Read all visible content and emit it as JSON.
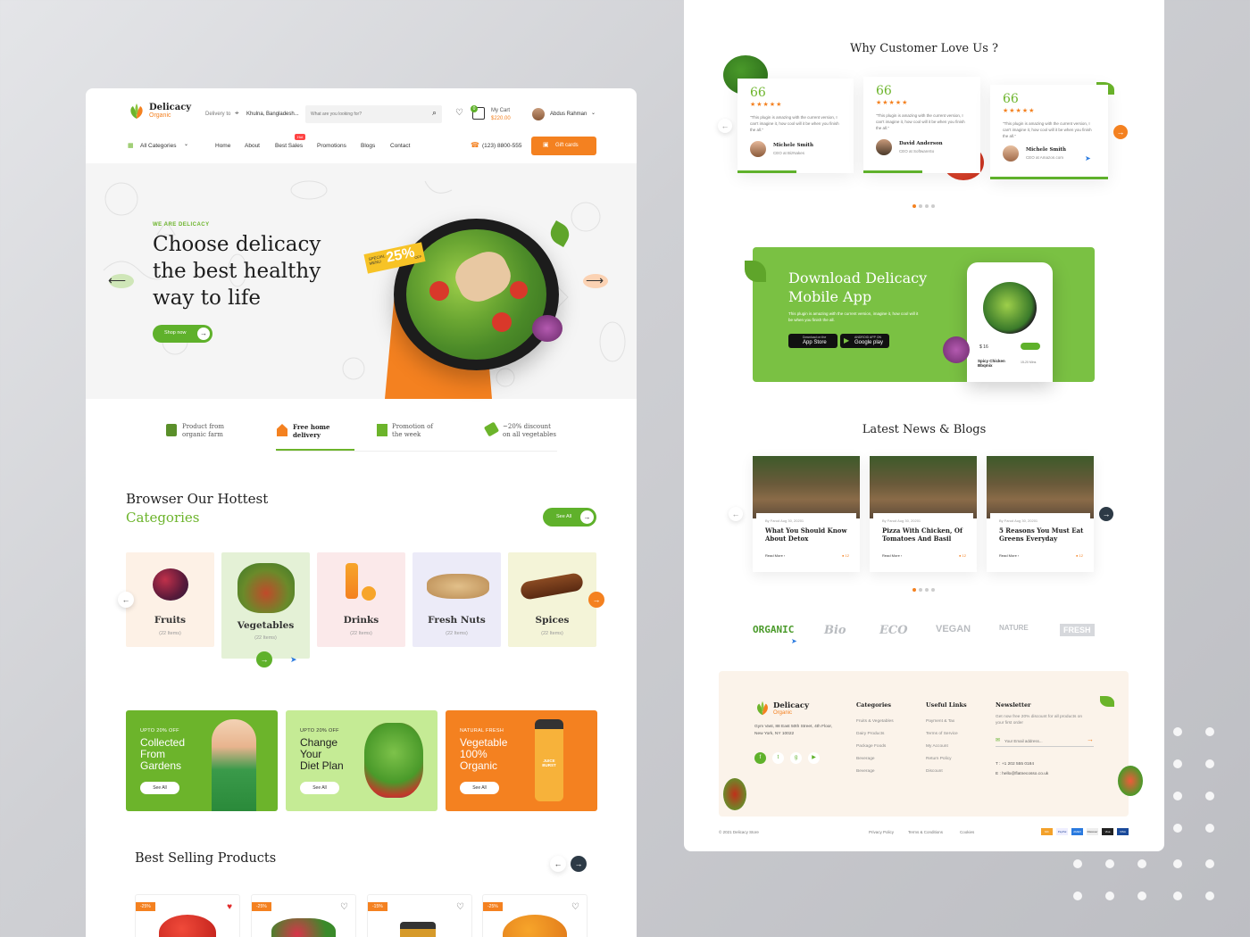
{
  "brand": {
    "name": "Delicacy",
    "sub": "Organic"
  },
  "header": {
    "delivery_label": "Delivery to",
    "location": "Khulna, Bangladesh...",
    "search_placeholder": "What are you looking for?",
    "cart_count": "0",
    "cart_label": "My Cart",
    "cart_total": "$220.00",
    "user_name": "Abdus Rahman"
  },
  "nav": {
    "all_categories": "All Categories",
    "links": [
      "Home",
      "About",
      "Best Sales",
      "Promotions",
      "Blogs",
      "Contact"
    ],
    "hot_badge": "Hot",
    "phone": "(123) 8800-555",
    "gift_cards": "Gift cards"
  },
  "hero": {
    "eyebrow": "WE ARE DELICACY",
    "title_lines": [
      "Choose delicacy",
      "the best healthy",
      "way to life"
    ],
    "cta": "Shop now",
    "badge_small": "SPECIAL MENU",
    "badge_big": "25%",
    "badge_off": "OFF"
  },
  "features": [
    {
      "line1": "Product from",
      "line2": "organic farm"
    },
    {
      "line1": "Free home",
      "line2": "delivery"
    },
    {
      "line1": "Promotion of",
      "line2": "the week"
    },
    {
      "line1": "~20% discount",
      "line2": "on all vegetables"
    }
  ],
  "categories_section": {
    "title": "Browser Our Hottest",
    "subtitle": "Categories",
    "see_all": "See All",
    "items": [
      {
        "name": "Fruits",
        "count": "(22 Items)"
      },
      {
        "name": "Vegetables",
        "count": "(22 Items)"
      },
      {
        "name": "Drinks",
        "count": "(22 Items)"
      },
      {
        "name": "Fresh Nuts",
        "count": "(22 Items)"
      },
      {
        "name": "Spices",
        "count": "(22 Items)"
      }
    ]
  },
  "promos": [
    {
      "tag": "UPTO 20% OFF",
      "lines": [
        "Collected",
        "From",
        "Gardens"
      ],
      "cta": "See All"
    },
    {
      "tag": "UPTO 20% OFF",
      "lines": [
        "Change",
        "Your",
        "Diet Plan"
      ],
      "cta": "See All"
    },
    {
      "tag": "NATURAL FRESH",
      "lines": [
        "Vegetable",
        "100%",
        "Organic"
      ],
      "cta": "See All",
      "bottle": "JUICE BURST"
    }
  ],
  "best_selling": {
    "title": "Best Selling Products",
    "discounts": [
      "-25%",
      "-25%",
      "-15%",
      "-25%"
    ]
  },
  "testimonials": {
    "title": "Why Customer Love Us ?",
    "text": "\"This plugin is amazing with the current version, I can't imagine it, how cool will it be when you finish the all.\"",
    "items": [
      {
        "name": "Michele Smith",
        "role": "CEO at BizNakes",
        "stars": "★★★★★"
      },
      {
        "name": "David Anderson",
        "role": "CEO at SoftwareSo",
        "stars": "★★★★★"
      },
      {
        "name": "Michele Smith",
        "role": "CEO at Amazon.com",
        "stars": "★★★★★"
      }
    ]
  },
  "app": {
    "title_lines": [
      "Download Delicacy",
      "Mobile App"
    ],
    "text": "This plugin is amazing with the current version, imagine it, how cool will it be when you finish the all.",
    "appstore_small": "Download on the",
    "appstore": "App Store",
    "googleplay_small": "ANDROID APP ON",
    "googleplay": "Google play",
    "phone_dish": "Spicy Chicken Bbqmix",
    "phone_price": "$ 16",
    "phone_time": "15-20 Mins"
  },
  "news": {
    "title": "Latest News & Blogs",
    "meta": "By Farud   Aug 30, 20201",
    "read_more": "Read More ›",
    "comments": "12",
    "items": [
      {
        "title": "What You Should Know About Detox"
      },
      {
        "title": "Pizza With Chicken, Of Tomatoes And Basil"
      },
      {
        "title": "5 Reasons You Must Eat Greens Everyday"
      }
    ]
  },
  "brands": [
    "ORGANIC",
    "Bio",
    "ECO",
    "VEGAN",
    "NATURE",
    "FRESH"
  ],
  "footer": {
    "address": "Gym Vast, 88 East 50th Street, 4th Floor, New York, NY 10022",
    "categories_title": "Categories",
    "categories": [
      "Fruits & Vegetables",
      "Dairy Products",
      "Package Foods",
      "Beverage",
      "Beverage"
    ],
    "links_title": "Useful Links",
    "links": [
      "Payment & Tax",
      "Terms of Service",
      "My Account",
      "Return Policy",
      "Discount"
    ],
    "newsletter_title": "Newsletter",
    "newsletter_text": "Get now free 20% discount for all products on your first order",
    "email_placeholder": "Your Email address...",
    "phone": "T : +1 202 555 0184",
    "email": "E : hello@flatnecosso.co.uk",
    "copyright": "© 2021 Delicacy Store",
    "bottom_links": [
      "Privacy Policy",
      "Terms & Conditions",
      "Cookies"
    ],
    "payments": [
      "MC",
      "PayPal",
      "AMEX",
      "Discover",
      "Visa",
      "VISA"
    ]
  }
}
